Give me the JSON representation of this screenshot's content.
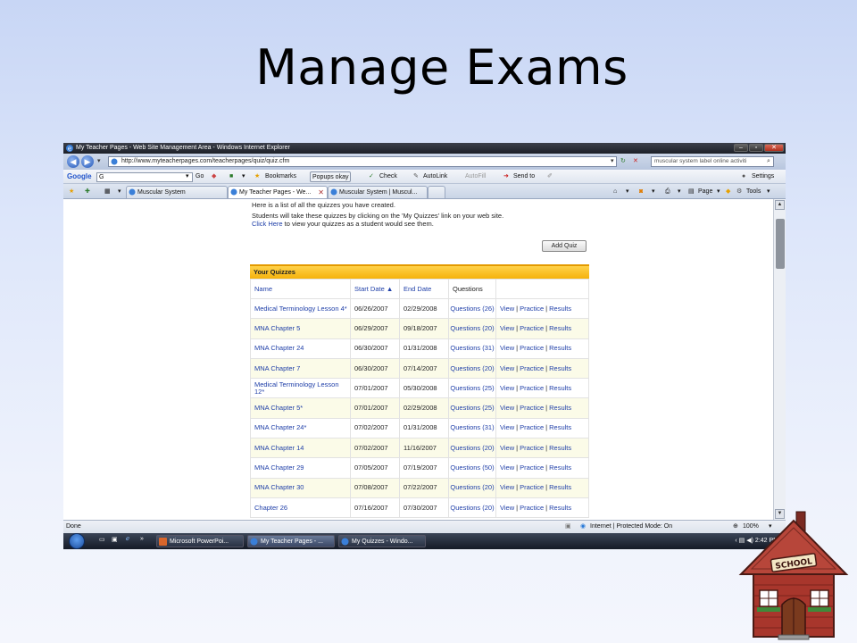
{
  "slide": {
    "title": "Manage Exams"
  },
  "window": {
    "title": "My Teacher Pages - Web Site Management Area - Windows Internet Explorer"
  },
  "address": {
    "url": "http://www.myteacherpages.com/teacherpages/quiz/quiz.cfm",
    "search_value": "muscular system label online activiti"
  },
  "google_toolbar": {
    "logo": "Google",
    "search_value": "G",
    "go": "Go",
    "bookmarks": "Bookmarks",
    "popups": "Popups okay",
    "check": "Check",
    "autolink": "AutoLink",
    "autofill": "AutoFill",
    "send_to": "Send to",
    "settings": "Settings"
  },
  "tabs": [
    {
      "label": "Muscular System"
    },
    {
      "label": "My Teacher Pages - We..."
    },
    {
      "label": "Muscular System | Muscul..."
    }
  ],
  "commands": {
    "page": "Page",
    "tools": "Tools"
  },
  "content": {
    "intro_line1": "Here is a list of all the quizzes you have created.",
    "intro_line2": "Students will take these quizzes by clicking on the 'My Quizzes' link on your web site.",
    "click_here": "Click Here",
    "intro_line3": " to view your quizzes as a student would see them.",
    "add_quiz": "Add Quiz",
    "panel_title": "Your Quizzes",
    "columns": {
      "name": "Name",
      "start_date": "Start Date ▲",
      "end_date": "End Date",
      "questions": "Questions"
    },
    "action_view": "View",
    "action_practice": "Practice",
    "action_results": "Results",
    "rows": [
      {
        "name": "Medical Terminology Lesson 4*",
        "start": "06/26/2007",
        "end": "02/29/2008",
        "questions": "Questions (26)"
      },
      {
        "name": "MNA Chapter 5",
        "start": "06/29/2007",
        "end": "09/18/2007",
        "questions": "Questions (20)"
      },
      {
        "name": "MNA Chapter 24",
        "start": "06/30/2007",
        "end": "01/31/2008",
        "questions": "Questions (31)"
      },
      {
        "name": "MNA Chapter 7",
        "start": "06/30/2007",
        "end": "07/14/2007",
        "questions": "Questions (20)"
      },
      {
        "name": "Medical Terminology Lesson 12*",
        "start": "07/01/2007",
        "end": "05/30/2008",
        "questions": "Questions (25)"
      },
      {
        "name": "MNA Chapter 5*",
        "start": "07/01/2007",
        "end": "02/29/2008",
        "questions": "Questions (25)"
      },
      {
        "name": "MNA Chapter 24*",
        "start": "07/02/2007",
        "end": "01/31/2008",
        "questions": "Questions (31)"
      },
      {
        "name": "MNA Chapter 14",
        "start": "07/02/2007",
        "end": "11/16/2007",
        "questions": "Questions (20)"
      },
      {
        "name": "MNA Chapter 29",
        "start": "07/05/2007",
        "end": "07/19/2007",
        "questions": "Questions (50)"
      },
      {
        "name": "MNA Chapter 30",
        "start": "07/08/2007",
        "end": "07/22/2007",
        "questions": "Questions (20)"
      },
      {
        "name": "Chapter 26",
        "start": "07/16/2007",
        "end": "07/30/2007",
        "questions": "Questions (20)"
      }
    ]
  },
  "status": {
    "left": "Done",
    "zone": "Internet | Protected Mode: On",
    "zoom": "100%"
  },
  "taskbar": {
    "items": [
      {
        "label": "Microsoft PowerPoi..."
      },
      {
        "label": "My Teacher Pages - ..."
      },
      {
        "label": "My Quizzes - Windo..."
      }
    ],
    "clock": "2:42 PM"
  },
  "clipart": {
    "sign": "SCHOOL"
  },
  "colors": {
    "accent_yellow": "#f5b20c",
    "link_blue": "#1f3fa8",
    "row_alt": "#fbfbe8"
  }
}
